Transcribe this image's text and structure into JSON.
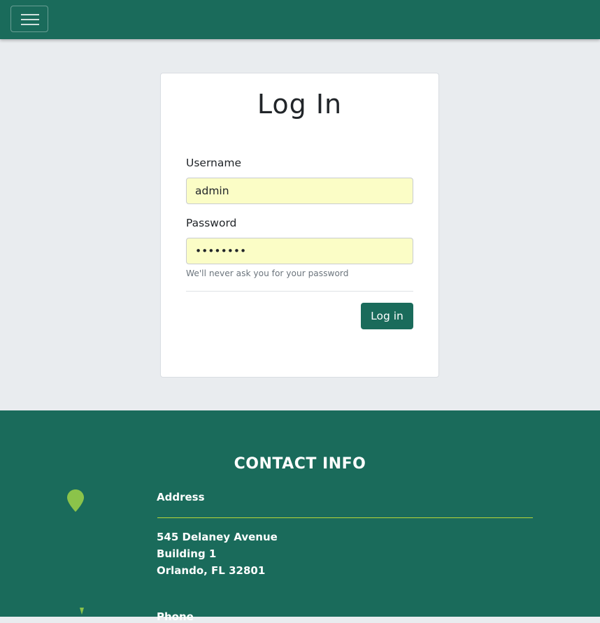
{
  "navbar": {
    "toggle_icon": "hamburger-menu-icon",
    "bg_color": "#1a6b5b"
  },
  "login": {
    "title": "Log In",
    "username_label": "Username",
    "username_value": "admin",
    "password_label": "Password",
    "password_value": "password",
    "password_help": "We'll never ask you for your password",
    "submit_label": "Log in",
    "input_bg": "#fbfdc6"
  },
  "footer": {
    "heading": "CONTACT INFO",
    "address": {
      "icon": "map-pin-icon",
      "label": "Address",
      "lines": [
        "545 Delaney Avenue",
        "Building 1",
        "Orlando, FL 32801"
      ]
    },
    "phone": {
      "icon": "phone-icon",
      "label": "Phone"
    },
    "accent_color": "#8bc34a"
  }
}
